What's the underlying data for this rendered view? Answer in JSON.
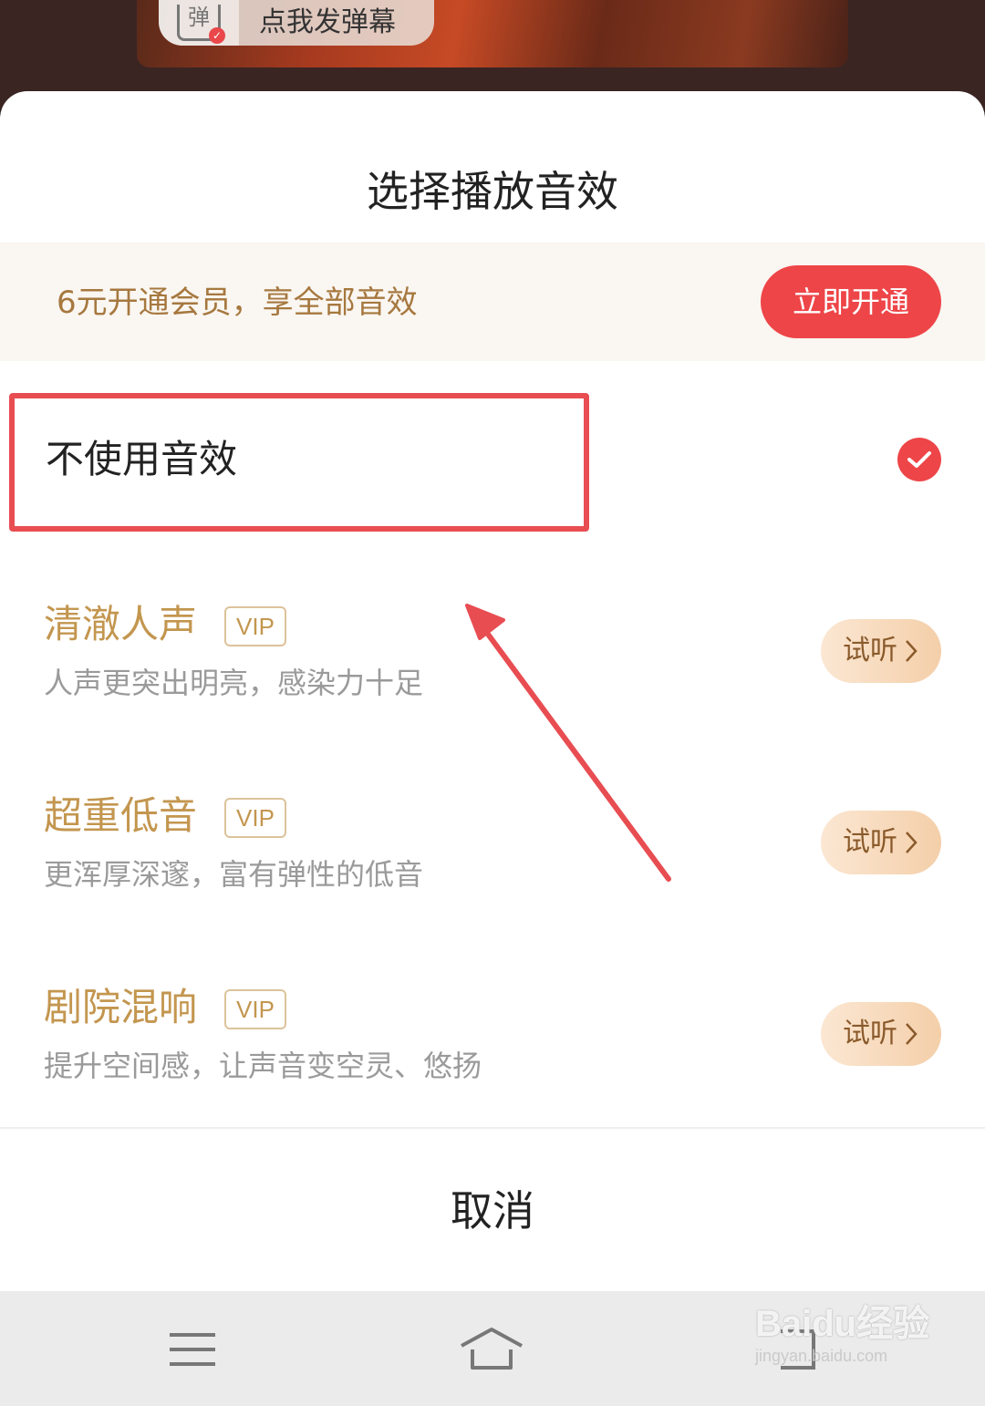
{
  "video": {
    "danmaku_icon_text": "弹",
    "danmaku_placeholder": "点我发弹幕"
  },
  "sheet": {
    "title": "选择播放音效",
    "vip_banner": {
      "text": "6元开通会员，享全部音效",
      "button_label": "立即开通"
    },
    "option_none": {
      "label": "不使用音效",
      "selected": true
    },
    "effects": [
      {
        "name": "清澈人声",
        "badge": "VIP",
        "description": "人声更突出明亮，感染力十足",
        "listen_label": "试听"
      },
      {
        "name": "超重低音",
        "badge": "VIP",
        "description": "更浑厚深邃，富有弹性的低音",
        "listen_label": "试听"
      },
      {
        "name": "剧院混响",
        "badge": "VIP",
        "description": "提升空间感，让声音变空灵、悠扬",
        "listen_label": "试听"
      }
    ],
    "cancel_label": "取消"
  },
  "colors": {
    "accent_red": "#ee4548",
    "gold_text": "#c3964f",
    "annotation_red": "#e84d52"
  },
  "navbar": {
    "icons": [
      "menu-icon",
      "home-icon",
      "back-icon"
    ]
  },
  "watermark": {
    "brand": "Baidu经验",
    "url": "jingyan.baidu.com"
  }
}
